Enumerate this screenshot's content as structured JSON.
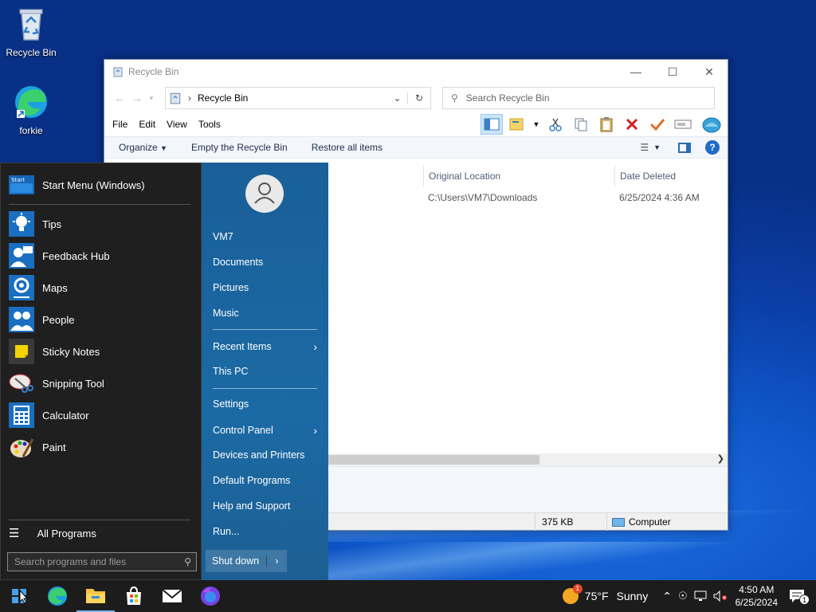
{
  "desktop": {
    "icons": [
      {
        "label": "Recycle Bin"
      },
      {
        "label": "forkie"
      }
    ]
  },
  "explorer": {
    "title": "Recycle Bin",
    "address": "Recycle Bin",
    "search_placeholder": "Search Recycle Bin",
    "menu": [
      "File",
      "Edit",
      "View",
      "Tools"
    ],
    "commands": {
      "organize": "Organize",
      "empty": "Empty the Recycle Bin",
      "restore": "Restore all items"
    },
    "columns": {
      "original_location": "Original Location",
      "date_deleted": "Date Deleted"
    },
    "rows": [
      {
        "original_location": "C:\\Users\\VM7\\Downloads",
        "date_deleted": "6/25/2024 4:36 AM"
      }
    ],
    "status": {
      "size": "375 KB",
      "location": "Computer"
    }
  },
  "start_menu": {
    "apps": [
      {
        "label": "Start Menu (Windows)"
      },
      {
        "label": "Tips"
      },
      {
        "label": "Feedback Hub"
      },
      {
        "label": "Maps"
      },
      {
        "label": "People"
      },
      {
        "label": "Sticky Notes"
      },
      {
        "label": "Snipping Tool"
      },
      {
        "label": "Calculator"
      },
      {
        "label": "Paint"
      }
    ],
    "all_programs": "All Programs",
    "search_placeholder": "Search programs and files",
    "right": {
      "user": "VM7",
      "documents": "Documents",
      "pictures": "Pictures",
      "music": "Music",
      "recent_items": "Recent Items",
      "this_pc": "This PC",
      "settings": "Settings",
      "control_panel": "Control Panel",
      "devices_printers": "Devices and Printers",
      "default_programs": "Default Programs",
      "help_support": "Help and Support",
      "run": "Run...",
      "shut_down": "Shut down"
    }
  },
  "taskbar": {
    "weather": {
      "temp": "75°F",
      "condition": "Sunny",
      "badge": "1"
    },
    "clock": {
      "time": "4:50 AM",
      "date": "6/25/2024"
    },
    "notifications": "1"
  },
  "colors": {
    "accent": "#1b6aa5",
    "taskbar": "#1c1c1c",
    "start_left": "#1f1f1f"
  }
}
